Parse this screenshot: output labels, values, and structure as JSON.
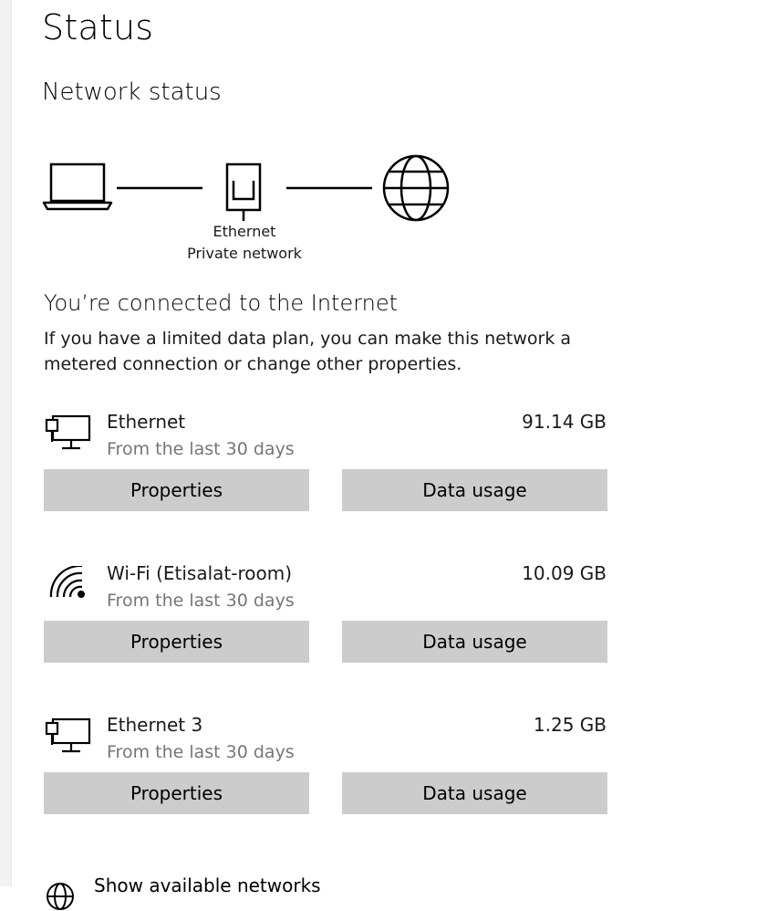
{
  "page": {
    "title": "Status"
  },
  "network_status": {
    "heading": "Network status",
    "diagram": {
      "connection_name": "Ethernet",
      "network_type": "Private network"
    }
  },
  "connection": {
    "title": "You’re connected to the Internet",
    "description": "If you have a limited data plan, you can make this network a metered connection or change other properties."
  },
  "networks": [
    {
      "name": "Ethernet",
      "period": "From the last 30 days",
      "usage": "91.14 GB",
      "icon": "ethernet-icon",
      "properties_label": "Properties",
      "data_usage_label": "Data usage"
    },
    {
      "name": "Wi-Fi (Etisalat-room)",
      "period": "From the last 30 days",
      "usage": "10.09 GB",
      "icon": "wifi-icon",
      "properties_label": "Properties",
      "data_usage_label": "Data usage"
    },
    {
      "name": "Ethernet 3",
      "period": "From the last 30 days",
      "usage": "1.25 GB",
      "icon": "ethernet-icon",
      "properties_label": "Properties",
      "data_usage_label": "Data usage"
    }
  ],
  "bottom": {
    "label": "Show available networks"
  }
}
